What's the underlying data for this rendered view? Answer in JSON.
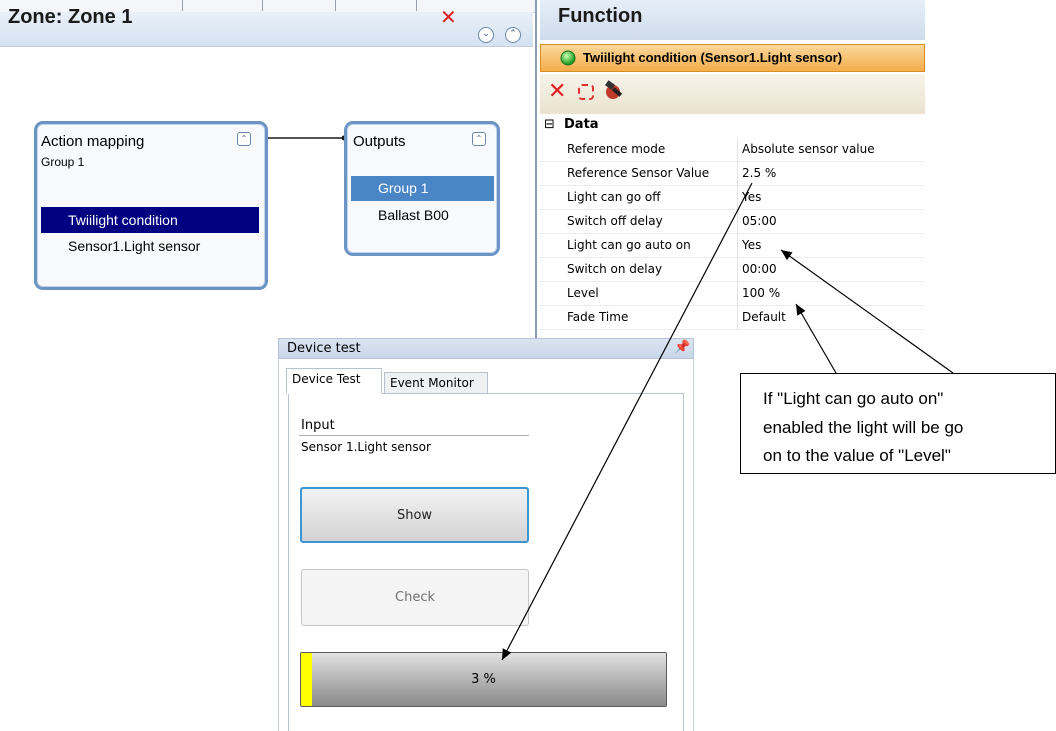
{
  "zone": {
    "title": "Zone: Zone 1",
    "close_icon": "x-icon"
  },
  "action_mapping": {
    "title": "Action mapping",
    "subtitle": "Group 1",
    "items": [
      {
        "label": "Twiilight condition",
        "selected": true
      },
      {
        "label": "Sensor1.Light sensor",
        "selected": false
      }
    ]
  },
  "outputs": {
    "title": "Outputs",
    "items": [
      {
        "label": "Group 1",
        "selected": true
      },
      {
        "label": "Ballast B00",
        "selected": false
      }
    ]
  },
  "function_panel": {
    "title": "Function",
    "condition": "Twiilight condition (Sensor1.Light sensor)",
    "toolbar_icons": [
      "delete-icon",
      "refresh-icon",
      "tool-icon"
    ],
    "section": "Data",
    "section_toggle": "⊟",
    "properties": [
      {
        "name": "Reference mode",
        "value": "Absolute sensor value"
      },
      {
        "name": "Reference Sensor Value",
        "value": "2.5 %"
      },
      {
        "name": "Light can go off",
        "value": "Yes"
      },
      {
        "name": "Switch off delay",
        "value": "05:00"
      },
      {
        "name": "Light can go auto on",
        "value": "Yes"
      },
      {
        "name": "Switch on delay",
        "value": "00:00"
      },
      {
        "name": "Level",
        "value": "100 %"
      },
      {
        "name": "Fade Time",
        "value": "Default"
      }
    ]
  },
  "device_test": {
    "title": "Device test",
    "pin_icon": "pin-icon",
    "tabs": [
      {
        "label": "Device Test",
        "active": true
      },
      {
        "label": "Event Monitor",
        "active": false
      }
    ],
    "input_label": "Input",
    "input_value": "Sensor 1.Light sensor",
    "show_button": "Show",
    "check_button": "Check",
    "progress_text": "3 %",
    "progress_fraction": 0.03
  },
  "callout": {
    "lines": [
      "If \"Light can go auto on\"",
      "enabled the light will be go",
      "on to the value of \"Level\""
    ]
  },
  "colors": {
    "selection_navy": "#000080",
    "selection_blue": "#4a86c5",
    "accent_orange": "#f3ad4c",
    "progress_yellow": "#ffff00",
    "focus_blue": "#3d95d4"
  }
}
